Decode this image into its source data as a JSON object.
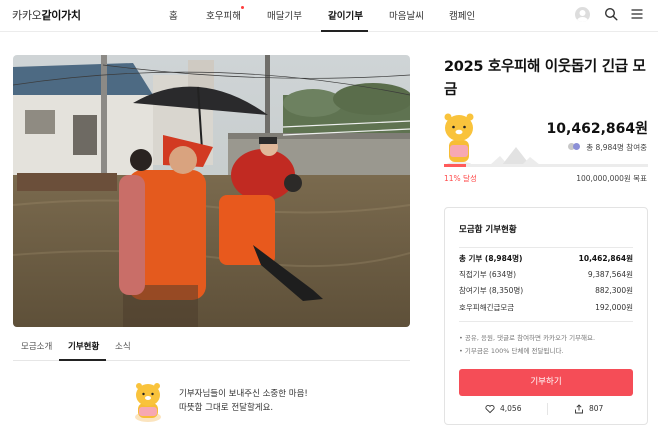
{
  "header": {
    "logo_brand": "카카오",
    "logo_bold": "같이가치",
    "nav": [
      {
        "label": "홈"
      },
      {
        "label": "호우피해"
      },
      {
        "label": "매달기부"
      },
      {
        "label": "같이기부"
      },
      {
        "label": "마음날씨"
      },
      {
        "label": "캠페인"
      }
    ],
    "active_tab": "같이기부",
    "icons": [
      "avatar-icon",
      "search-icon",
      "menu-icon"
    ]
  },
  "campaign": {
    "title": "2025 호우피해 이웃돕기 긴급 모금",
    "raised": "10,462,864원",
    "participants": "총 8,984명 참여중",
    "progress_percent": 11,
    "progress_label": "11% 달성",
    "goal": "100,000,000원 목표"
  },
  "content_tabs": [
    {
      "label": "모금소개"
    },
    {
      "label": "기부현황"
    },
    {
      "label": "소식"
    }
  ],
  "thanks": {
    "line1": "기부자님들이 보내주신 소중한 마음!",
    "line2": "따뜻함 그대로 전달할게요."
  },
  "donation_box": {
    "title": "모금함 기부현황",
    "rows": [
      {
        "label": "총 기부 (8,984명)",
        "value": "10,462,864원"
      },
      {
        "label": "직접기부 (634명)",
        "value": "9,387,564원"
      },
      {
        "label": "참여기부 (8,350명)",
        "value": "882,300원"
      },
      {
        "label": "호우피해긴급모금",
        "value": "192,000원"
      }
    ],
    "notes": [
      "• 공유, 응원, 댓글로 참여하면 카카오가 기부해요.",
      "• 기부금은 100% 단체에 전달됩니다."
    ],
    "donate_label": "기부하기",
    "likes": "4,056",
    "shares": "807"
  },
  "colors": {
    "accent": "#f54d57",
    "progress": "#ff5a5a",
    "new_dot": "#ff3d3d"
  }
}
